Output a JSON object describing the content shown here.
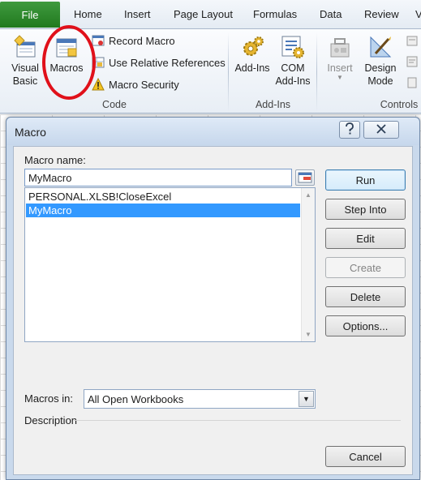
{
  "ribbon": {
    "tabs": {
      "file": "File",
      "home": "Home",
      "insert": "Insert",
      "page_layout": "Page Layout",
      "formulas": "Formulas",
      "data": "Data",
      "review": "Review",
      "view_partial": "V"
    },
    "code_group": {
      "label": "Code",
      "visual_basic_line1": "Visual",
      "visual_basic_line2": "Basic",
      "macros": "Macros",
      "record_macro": "Record Macro",
      "use_relative_references": "Use Relative References",
      "macro_security": "Macro Security"
    },
    "addins_group": {
      "label": "Add-Ins",
      "addins": "Add-Ins",
      "com_line1": "COM",
      "com_line2": "Add-Ins"
    },
    "controls_group": {
      "label": "Controls",
      "insert": "Insert",
      "design_line1": "Design",
      "design_line2": "Mode"
    }
  },
  "dialog": {
    "title": "Macro",
    "help_icon": "question-icon",
    "close_icon": "close-icon",
    "macro_name_label": "Macro name:",
    "macro_name_value": "MyMacro",
    "macros": [
      {
        "name": "PERSONAL.XLSB!CloseExcel",
        "selected": false
      },
      {
        "name": "MyMacro",
        "selected": true
      }
    ],
    "macros_in_label": "Macros in:",
    "macros_in_value": "All Open Workbooks",
    "description_label": "Description",
    "buttons": {
      "run": "Run",
      "step_into": "Step Into",
      "edit": "Edit",
      "create": "Create",
      "delete": "Delete",
      "options": "Options...",
      "cancel": "Cancel"
    }
  },
  "colors": {
    "file_tab": "#217a1f",
    "selection": "#3399ff",
    "highlight_circle": "#e0101a"
  }
}
